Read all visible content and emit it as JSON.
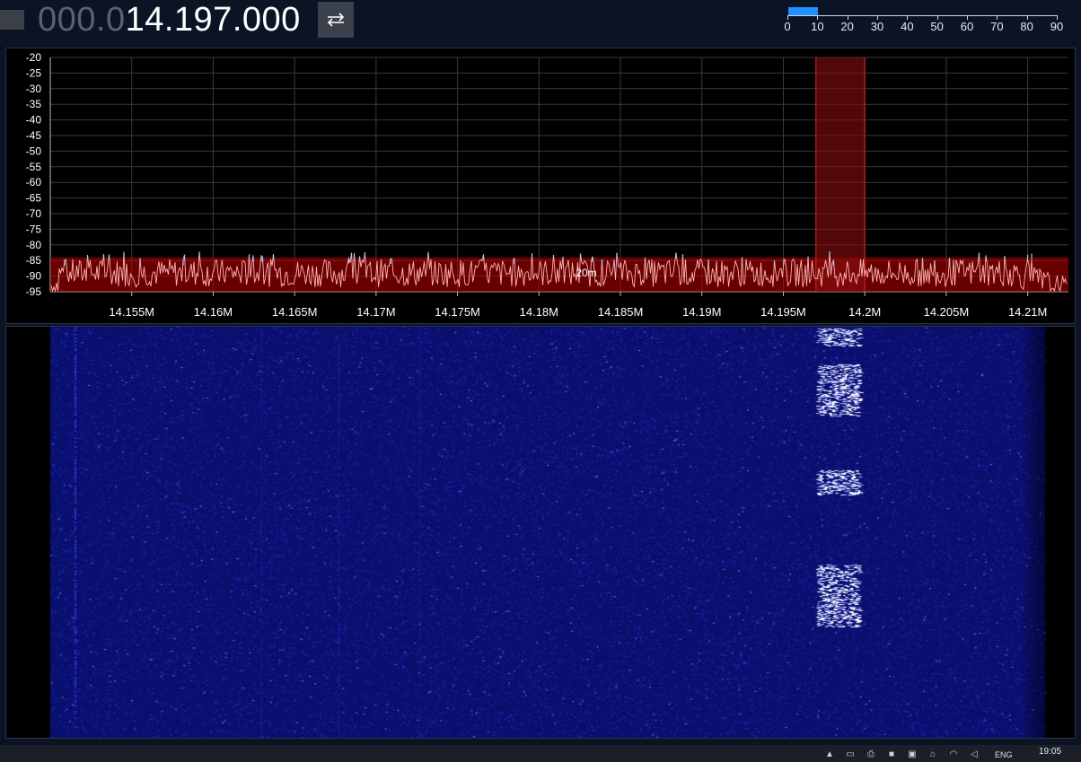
{
  "frequency": {
    "dim_part": "000.0",
    "bright_part": "14.197.000"
  },
  "swap_button": {
    "icon": "swap-arrows-icon"
  },
  "smeter": {
    "ticks": [
      "0",
      "10",
      "20",
      "30",
      "40",
      "50",
      "60",
      "70",
      "80",
      "90"
    ],
    "level": 10,
    "max": 90,
    "fill_color": "#1e90ff"
  },
  "spectrum": {
    "y_ticks": [
      "-20",
      "-25",
      "-30",
      "-35",
      "-40",
      "-45",
      "-50",
      "-55",
      "-60",
      "-65",
      "-70",
      "-75",
      "-80",
      "-85",
      "-90",
      "-95"
    ],
    "x_ticks": [
      "14.155M",
      "14.16M",
      "14.165M",
      "14.17M",
      "14.175M",
      "14.18M",
      "14.185M",
      "14.19M",
      "14.195M",
      "14.2M",
      "14.205M",
      "14.21M"
    ],
    "band_label": "20m",
    "band_color": "#c00000",
    "trace_color": "#ffb3b3",
    "peak_color": "#8fd0ff"
  },
  "waterfall": {
    "bg_color": "#0a0f6e"
  },
  "taskbar": {
    "tray_icons": [
      "up-arrow-icon",
      "monitor-icon",
      "printer-icon",
      "app-icon",
      "folder-icon",
      "network-icon",
      "wifi-icon",
      "volume-icon"
    ],
    "lang": "ENG",
    "time": "19:05"
  }
}
